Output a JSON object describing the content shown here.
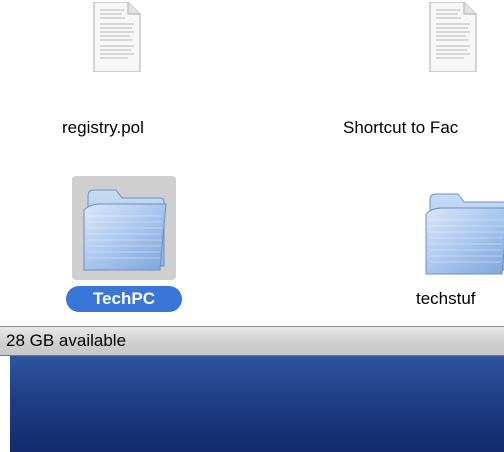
{
  "window": {
    "items": [
      {
        "label": "registry.pol",
        "type": "document",
        "icon": "document-icon"
      },
      {
        "label": "Shortcut to Fac",
        "type": "document",
        "icon": "document-icon"
      },
      {
        "label": "TechPC",
        "type": "folder",
        "icon": "folder-icon",
        "selected": true
      },
      {
        "label": "techstuf",
        "type": "folder",
        "icon": "folder-icon"
      }
    ]
  },
  "status_bar": {
    "available_text": "28 GB available"
  },
  "colors": {
    "selection_label": "#3a76d8",
    "selection_box": "#cfcfcf",
    "desktop_blue": "#1f3d86"
  }
}
